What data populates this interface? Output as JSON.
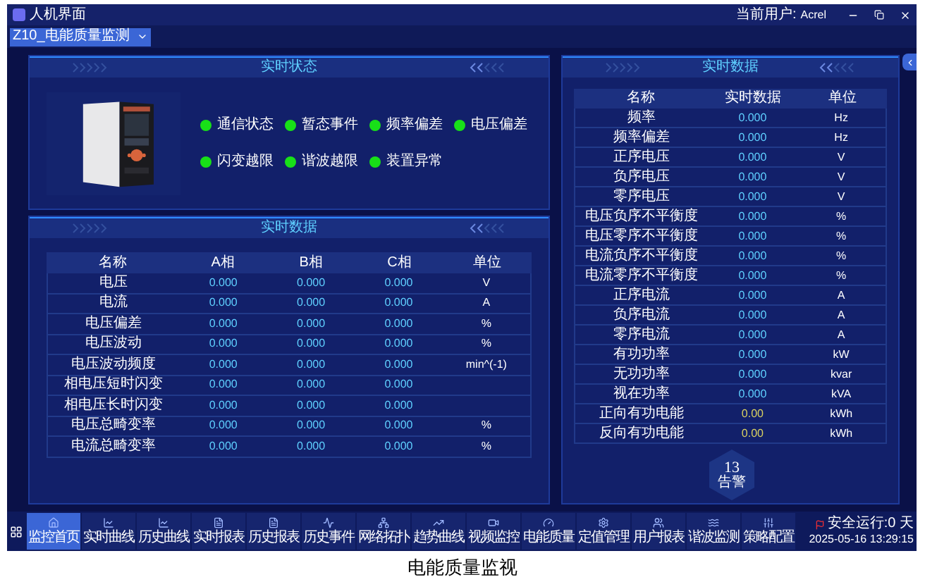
{
  "window": {
    "title": "人机界面",
    "user_label": "当前用户:",
    "user": "Acrel"
  },
  "device_select": {
    "value": "Z10_电能质量监测"
  },
  "status_panel": {
    "title": "实时状态",
    "items": [
      {
        "label": "通信状态",
        "on": true
      },
      {
        "label": "暂态事件",
        "on": true
      },
      {
        "label": "频率偏差",
        "on": true
      },
      {
        "label": "电压偏差",
        "on": true
      },
      {
        "label": "闪变越限",
        "on": true
      },
      {
        "label": "谐波越限",
        "on": true
      },
      {
        "label": "装置异常",
        "on": true
      }
    ]
  },
  "phase_panel": {
    "title": "实时数据",
    "columns": [
      "名称",
      "A相",
      "B相",
      "C相",
      "单位"
    ],
    "rows": [
      [
        "电压",
        "0.000",
        "0.000",
        "0.000",
        "V"
      ],
      [
        "电流",
        "0.000",
        "0.000",
        "0.000",
        "A"
      ],
      [
        "电压偏差",
        "0.000",
        "0.000",
        "0.000",
        "%"
      ],
      [
        "电压波动",
        "0.000",
        "0.000",
        "0.000",
        "%"
      ],
      [
        "电压波动频度",
        "0.000",
        "0.000",
        "0.000",
        "min^(-1)"
      ],
      [
        "相电压短时闪变",
        "0.000",
        "0.000",
        "0.000",
        ""
      ],
      [
        "相电压长时闪变",
        "0.000",
        "0.000",
        "0.000",
        ""
      ],
      [
        "电压总畸变率",
        "0.000",
        "0.000",
        "0.000",
        "%"
      ],
      [
        "电流总畸变率",
        "0.000",
        "0.000",
        "0.000",
        "%"
      ]
    ]
  },
  "data_panel": {
    "title": "实时数据",
    "columns": [
      "名称",
      "实时数据",
      "单位"
    ],
    "rows": [
      {
        "kind": "measure",
        "cells": [
          "频率",
          "0.000",
          "Hz"
        ]
      },
      {
        "kind": "measure",
        "cells": [
          "频率偏差",
          "0.000",
          "Hz"
        ]
      },
      {
        "kind": "measure",
        "cells": [
          "正序电压",
          "0.000",
          "V"
        ]
      },
      {
        "kind": "measure",
        "cells": [
          "负序电压",
          "0.000",
          "V"
        ]
      },
      {
        "kind": "measure",
        "cells": [
          "零序电压",
          "0.000",
          "V"
        ]
      },
      {
        "kind": "measure",
        "cells": [
          "电压负序不平衡度",
          "0.000",
          "%"
        ]
      },
      {
        "kind": "measure",
        "cells": [
          "电压零序不平衡度",
          "0.000",
          "%"
        ]
      },
      {
        "kind": "measure",
        "cells": [
          "电流负序不平衡度",
          "0.000",
          "%"
        ]
      },
      {
        "kind": "measure",
        "cells": [
          "电流零序不平衡度",
          "0.000",
          "%"
        ]
      },
      {
        "kind": "measure",
        "cells": [
          "正序电流",
          "0.000",
          "A"
        ]
      },
      {
        "kind": "measure",
        "cells": [
          "负序电流",
          "0.000",
          "A"
        ]
      },
      {
        "kind": "measure",
        "cells": [
          "零序电流",
          "0.000",
          "A"
        ]
      },
      {
        "kind": "measure",
        "cells": [
          "有功功率",
          "0.000",
          "kW"
        ]
      },
      {
        "kind": "measure",
        "cells": [
          "无功功率",
          "0.000",
          "kvar"
        ]
      },
      {
        "kind": "measure",
        "cells": [
          "视在功率",
          "0.000",
          "kVA"
        ]
      },
      {
        "kind": "energy",
        "cells": [
          "正向有功电能",
          "0.00",
          "kWh"
        ]
      },
      {
        "kind": "energy",
        "cells": [
          "反向有功电能",
          "0.00",
          "kWh"
        ]
      }
    ]
  },
  "alarm_badge": {
    "count": "13",
    "label": "告警"
  },
  "taskbar": {
    "items": [
      {
        "label": "监控首页",
        "selected": true
      },
      {
        "label": "实时曲线",
        "selected": false
      },
      {
        "label": "历史曲线",
        "selected": false
      },
      {
        "label": "实时报表",
        "selected": false
      },
      {
        "label": "历史报表",
        "selected": false
      },
      {
        "label": "历史事件",
        "selected": false
      },
      {
        "label": "网络拓扑",
        "selected": false
      },
      {
        "label": "趋势曲线",
        "selected": false
      },
      {
        "label": "视频监控",
        "selected": false
      },
      {
        "label": "电能质量",
        "selected": false
      },
      {
        "label": "定值管理",
        "selected": false
      },
      {
        "label": "用户报表",
        "selected": false
      },
      {
        "label": "谐波监测",
        "selected": false
      },
      {
        "label": "策略配置",
        "selected": false
      }
    ],
    "safe_days": "安全运行:0 天",
    "datetime": "2025-05-16 13:29:15"
  },
  "caption": "电能质量监视"
}
